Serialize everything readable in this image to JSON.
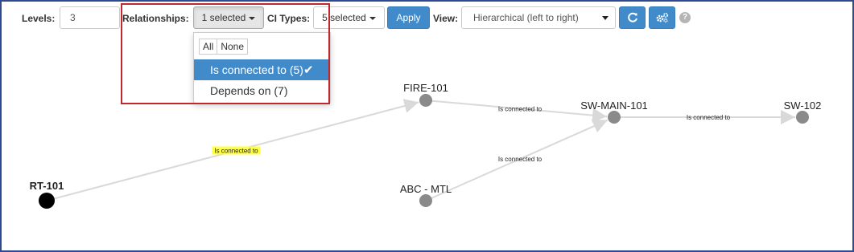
{
  "toolbar": {
    "levels_label": "Levels:",
    "levels_value": "3",
    "relationships_label": "Relationships:",
    "relationships_button": "1 selected",
    "ci_types_label": "CI Types:",
    "ci_types_button": "5 selected",
    "apply_label": "Apply",
    "view_label": "View:",
    "view_selected": "Hierarchical (left to right)",
    "refresh_icon": "refresh-icon",
    "settings_icon": "gears-icon",
    "help_icon": "question-circle-icon",
    "help_glyph": "?"
  },
  "relationships_dropdown": {
    "all_label": "All",
    "none_label": "None",
    "items": [
      {
        "label": "Is connected to (5)",
        "selected": true,
        "check": "✔"
      },
      {
        "label": "Depends on (7)",
        "selected": false
      }
    ]
  },
  "graph": {
    "nodes": [
      {
        "id": "RT-101",
        "label": "RT-101",
        "root": true
      },
      {
        "id": "FIRE-101",
        "label": "FIRE-101"
      },
      {
        "id": "SW-MAIN-101",
        "label": "SW-MAIN-101"
      },
      {
        "id": "SW-102",
        "label": "SW-102"
      },
      {
        "id": "ABC-MTL",
        "label": "ABC - MTL"
      }
    ],
    "edges": [
      {
        "from": "RT-101",
        "to": "FIRE-101",
        "label": "Is connected to",
        "highlighted": true
      },
      {
        "from": "FIRE-101",
        "to": "SW-MAIN-101",
        "label": "Is connected to"
      },
      {
        "from": "SW-MAIN-101",
        "to": "SW-102",
        "label": "Is connected to"
      },
      {
        "from": "ABC-MTL",
        "to": "SW-MAIN-101",
        "label": "Is connected to"
      }
    ],
    "colors": {
      "node": "#8a8a8a",
      "root_node": "#000000",
      "edge": "#d9d9d9",
      "label_highlight": "#ffff44"
    }
  },
  "colors": {
    "primary": "#428bca",
    "frame_border": "#2d4b8e",
    "highlight_border": "#c0282d"
  }
}
